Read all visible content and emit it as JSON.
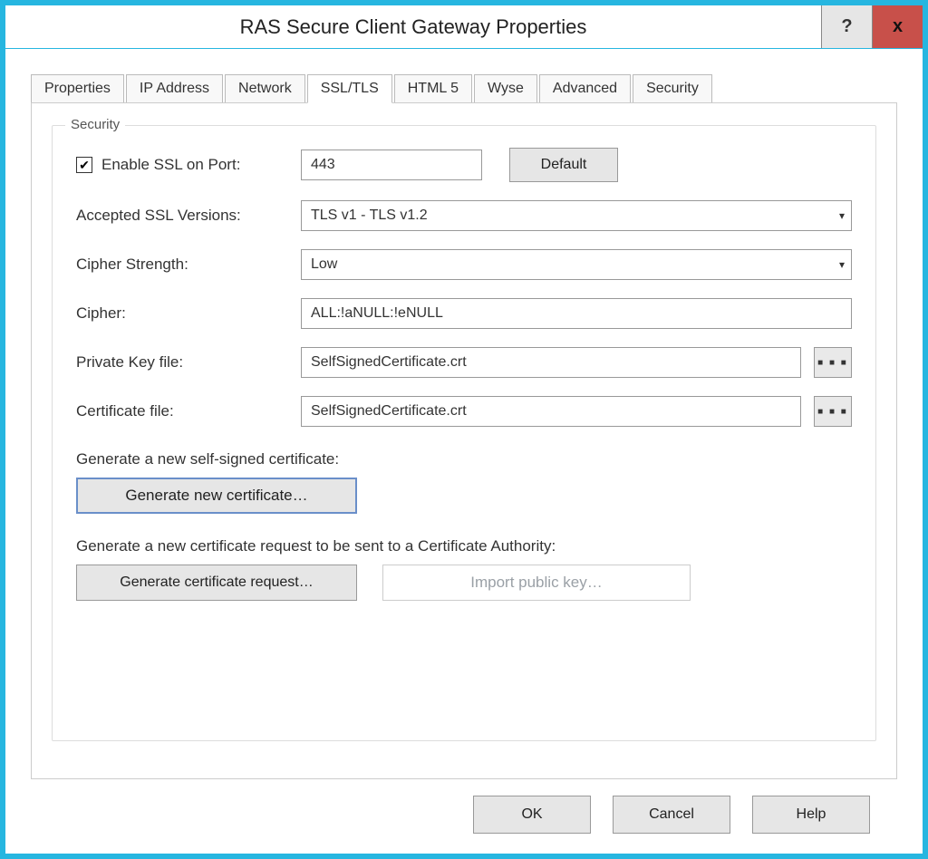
{
  "window": {
    "title": "RAS Secure Client Gateway Properties",
    "help_symbol": "?",
    "close_symbol": "x"
  },
  "tabs": [
    "Properties",
    "IP Address",
    "Network",
    "SSL/TLS",
    "HTML 5",
    "Wyse",
    "Advanced",
    "Security"
  ],
  "active_tab_index": 3,
  "group_legend": "Security",
  "enable_ssl": {
    "checked": true,
    "label": "Enable SSL on Port:",
    "port_value": "443",
    "default_button": "Default"
  },
  "fields": {
    "accepted_versions_label": "Accepted SSL Versions:",
    "accepted_versions_value": "TLS v1 - TLS v1.2",
    "cipher_strength_label": "Cipher Strength:",
    "cipher_strength_value": "Low",
    "cipher_label": "Cipher:",
    "cipher_value": "ALL:!aNULL:!eNULL",
    "private_key_label": "Private Key file:",
    "private_key_value": "SelfSignedCertificate.crt",
    "cert_file_label": "Certificate file:",
    "cert_file_value": "SelfSignedCertificate.crt"
  },
  "browse_label": "■ ■ ■",
  "self_signed_section": "Generate a new self-signed certificate:",
  "gen_cert_button": "Generate new certificate…",
  "csr_section": "Generate a new certificate request to be sent to a Certificate Authority:",
  "gen_csr_button": "Generate certificate request…",
  "import_pubkey_button": "Import public key…",
  "footer": {
    "ok": "OK",
    "cancel": "Cancel",
    "help": "Help"
  }
}
